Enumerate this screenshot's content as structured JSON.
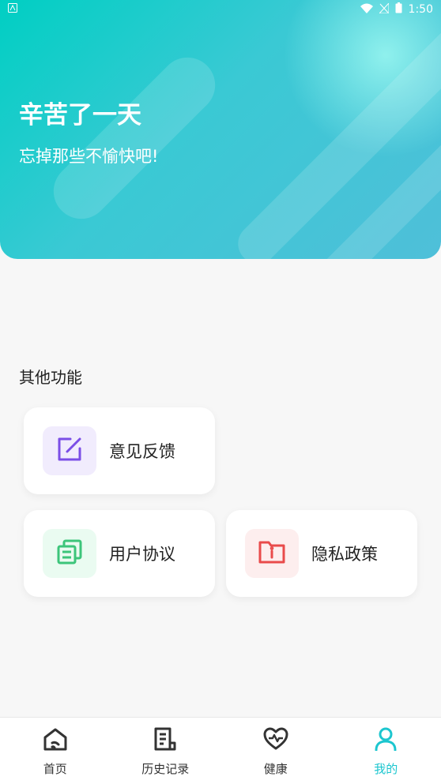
{
  "status_bar": {
    "time": "1:50"
  },
  "hero": {
    "title": "辛苦了一天",
    "subtitle": "忘掉那些不愉快吧!"
  },
  "section": {
    "title": "其他功能"
  },
  "cards": [
    {
      "label": "意见反馈",
      "icon": "edit-icon",
      "icon_color": "#7b4ee6",
      "bg": "#f1ecfd"
    },
    {
      "label": "用户协议",
      "icon": "document-copy-icon",
      "icon_color": "#3cc57a",
      "bg": "#eafbf1"
    },
    {
      "label": "隐私政策",
      "icon": "folder-info-icon",
      "icon_color": "#e94b4b",
      "bg": "#fdeeee"
    }
  ],
  "nav": {
    "active_color": "#1cc6cf",
    "items": [
      {
        "label": "首页",
        "icon": "home-icon"
      },
      {
        "label": "历史记录",
        "icon": "history-icon"
      },
      {
        "label": "健康",
        "icon": "heart-pulse-icon"
      },
      {
        "label": "我的",
        "icon": "user-icon",
        "active": true
      }
    ]
  }
}
